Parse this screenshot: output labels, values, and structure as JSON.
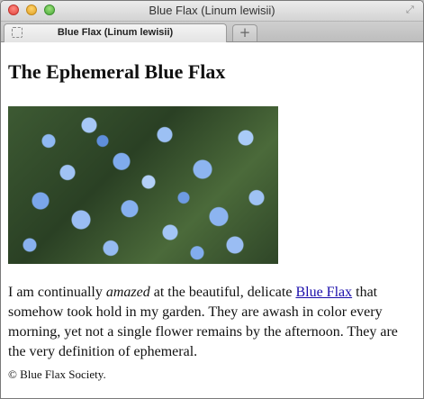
{
  "window": {
    "title": "Blue Flax (Linum lewisii)"
  },
  "tabs": {
    "active_label": "Blue Flax (Linum lewisii)",
    "new_tab_label": "+"
  },
  "page": {
    "heading": "The Ephemeral Blue Flax",
    "image_subject": "field of blue flax flowers",
    "paragraph": {
      "before_em": "I am continually ",
      "em": "amazed",
      "after_em": " at the beautiful, delicate ",
      "link": "Blue Flax",
      "after_link": " that somehow took hold in my garden. They are awash in color every morning, yet not a single flower remains by the afternoon. They are the very definition of ephemeral."
    },
    "footer": "© Blue Flax Society."
  },
  "colors": {
    "link": "#1a0dab",
    "close": "#e0443e",
    "minimize": "#dfa124",
    "maximize": "#4aa83a"
  }
}
